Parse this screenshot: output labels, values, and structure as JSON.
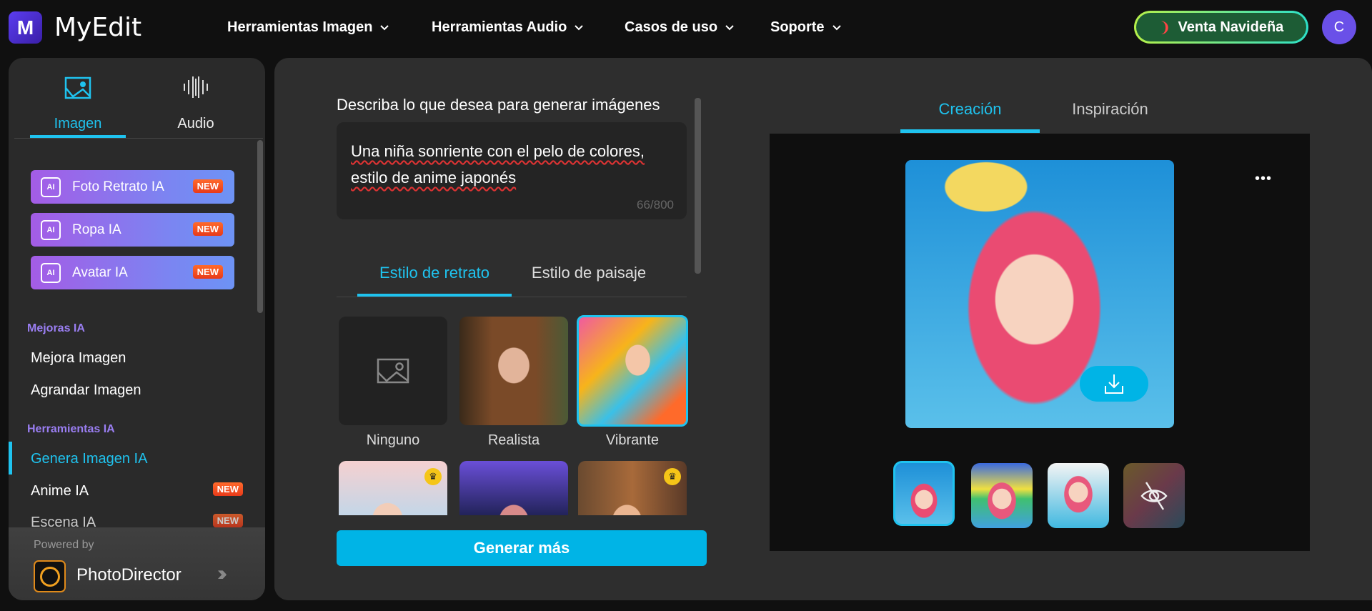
{
  "header": {
    "logo_text": "MyEdit",
    "logo_letter": "M",
    "nav": [
      {
        "label": "Herramientas Imagen"
      },
      {
        "label": "Herramientas Audio"
      },
      {
        "label": "Casos de uso"
      },
      {
        "label": "Soporte"
      }
    ],
    "promo_label": "Venta Navideña",
    "avatar_letter": "C"
  },
  "sidebar": {
    "tabs": [
      {
        "label": "Imagen",
        "active": true
      },
      {
        "label": "Audio",
        "active": false
      }
    ],
    "ai_buttons": [
      {
        "label": "Foto Retrato IA",
        "badge": "NEW"
      },
      {
        "label": "Ropa IA",
        "badge": "NEW"
      },
      {
        "label": "Avatar IA",
        "badge": "NEW"
      }
    ],
    "sections": [
      {
        "title": "Mejoras IA",
        "items": [
          {
            "label": "Mejora Imagen"
          },
          {
            "label": "Agrandar Imagen"
          }
        ]
      },
      {
        "title": "Herramientas IA",
        "items": [
          {
            "label": "Genera Imagen IA",
            "active": true
          },
          {
            "label": "Anime IA",
            "badge": "NEW"
          },
          {
            "label": "Escena IA",
            "badge": "NEW"
          }
        ]
      }
    ],
    "powered_by": "Powered by",
    "product": "PhotoDirector"
  },
  "editor": {
    "prompt_label": "Describa lo que desea para generar imágenes",
    "prompt_value": "Una niña sonriente con el pelo de colores, estilo de anime japonés",
    "char_count": "66/800",
    "style_tabs": [
      {
        "label": "Estilo de retrato",
        "active": true
      },
      {
        "label": "Estilo de paisaje",
        "active": false
      }
    ],
    "styles": [
      {
        "label": "Ninguno"
      },
      {
        "label": "Realista"
      },
      {
        "label": "Vibrante",
        "selected": true
      }
    ],
    "generate_label": "Generar más"
  },
  "result": {
    "tabs": [
      {
        "label": "Creación",
        "active": true
      },
      {
        "label": "Inspiración",
        "active": false
      }
    ],
    "more_label": "•••",
    "thumbnails": 4
  },
  "colors": {
    "accent": "#00b4e6",
    "purple": "#9a7ef2",
    "badge": "#f0481f",
    "promo_bg": "#1d5c35"
  }
}
